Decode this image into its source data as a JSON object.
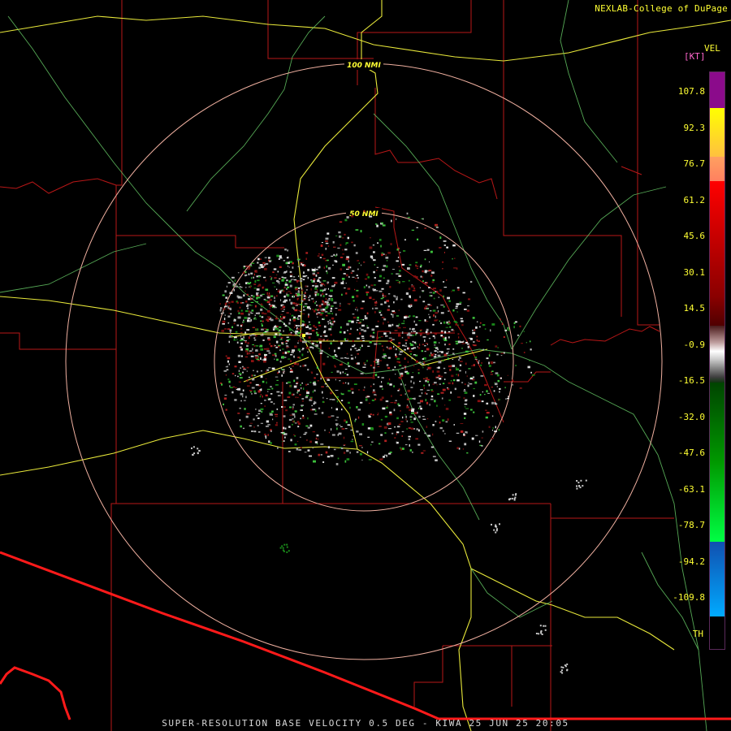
{
  "credit": "NEXLAB-College of DuPage",
  "legend": {
    "product": "VEL",
    "unit": "[KT]",
    "ticks": [
      "107.8",
      "92.3",
      "76.7",
      "61.2",
      "45.6",
      "30.1",
      "14.5",
      "-0.9",
      "-16.5",
      "-32.0",
      "-47.6",
      "-63.1",
      "-78.7",
      "-94.2",
      "-109.8",
      "TH"
    ]
  },
  "range_rings": [
    "100 NMI",
    "50 NMI"
  ],
  "footer": "SUPER-RESOLUTION BASE VELOCITY 0.5 DEG - KIWA 25 JUN 25 20:05",
  "colors": {
    "state_border": "#ff1a1a",
    "county_lines": "#c01818",
    "highways": "#ffff33",
    "rivers": "#66dd66",
    "range_rings": "#f0b0a0",
    "background": "#000000"
  },
  "icons": [
    "radar-site-icon"
  ]
}
